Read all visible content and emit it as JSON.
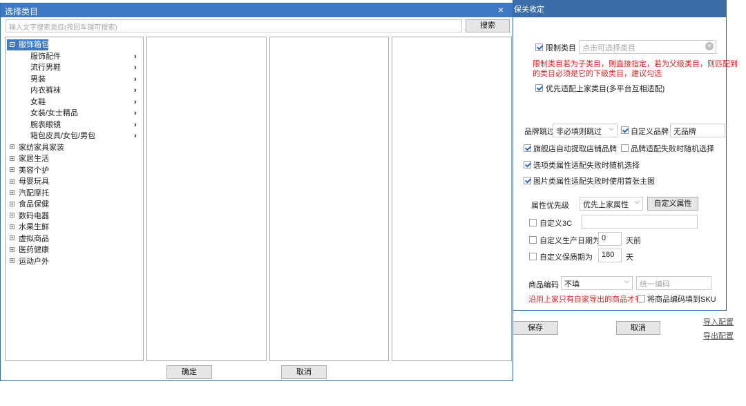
{
  "dialog": {
    "title": "选择类目",
    "close_glyph": "×",
    "search_placeholder": "输入文字搜索类目(按回车键可搜索)",
    "search_button": "搜索",
    "ok_button": "确定",
    "cancel_button": "取消",
    "tree": [
      {
        "label": "服饰箱包",
        "expanded": true,
        "selected": true
      },
      {
        "label": "服饰配件",
        "child": true
      },
      {
        "label": "流行男鞋",
        "child": true
      },
      {
        "label": "男装",
        "child": true
      },
      {
        "label": "内衣裤袜",
        "child": true
      },
      {
        "label": "女鞋",
        "child": true
      },
      {
        "label": "女装/女士精品",
        "child": true
      },
      {
        "label": "腕表眼镜",
        "child": true
      },
      {
        "label": "箱包皮具/女包/男包",
        "child": true
      },
      {
        "label": "家纺家具家装",
        "expanded": false
      },
      {
        "label": "家居生活",
        "expanded": false
      },
      {
        "label": "美容个护",
        "expanded": false
      },
      {
        "label": "母婴玩具",
        "expanded": false
      },
      {
        "label": "汽配摩托",
        "expanded": false
      },
      {
        "label": "食品保健",
        "expanded": false
      },
      {
        "label": "数码电器",
        "expanded": false
      },
      {
        "label": "水果生鲜",
        "expanded": false
      },
      {
        "label": "虚拟商品",
        "expanded": false
      },
      {
        "label": "医药健康",
        "expanded": false
      },
      {
        "label": "运动户外",
        "expanded": false
      }
    ],
    "expand_glyph": "+",
    "collapse_glyph": "−",
    "chevron_glyph": "›"
  },
  "config": {
    "top_partial_text": "保关收定",
    "limit_category_label": "限制类目",
    "limit_category_checked": true,
    "category_placeholder": "点击可选择类目",
    "clear_glyph": "✕",
    "limit_note_line1": "限制类目若为子类目，则直接指定，若为父级类目，则匹配到",
    "limit_note_line2": "的类目必须是它的下级类目，建议勾选",
    "prefer_source_label": "优先适配上家类目(多平台互相适配)",
    "prefer_source_checked": true,
    "brand_skip_label": "品牌跳过",
    "brand_skip_value": "非必填则跳过",
    "custom_brand_label": "自定义品牌",
    "custom_brand_checked": true,
    "custom_brand_value": "无品牌",
    "flagship_label": "旗舰店自动提取店铺品牌",
    "flagship_checked": true,
    "brand_random_label": "品牌适配失败时随机选择",
    "brand_random_checked": false,
    "option_random_label": "选项类属性适配失败时随机选择",
    "option_random_checked": true,
    "image_first_label": "图片类属性适配失败时使用首张主图",
    "image_first_checked": true,
    "attr_priority_label": "属性优先级",
    "attr_priority_value": "优先上家属性",
    "custom_attr_button": "自定义属性",
    "custom_3c_label": "自定义3C",
    "custom_3c_checked": false,
    "custom_3c_value": "",
    "prod_date_label": "自定义生产日期为",
    "prod_date_checked": false,
    "prod_date_value": "0",
    "prod_date_unit": "天前",
    "shelf_life_label": "自定义保质期为",
    "shelf_life_checked": false,
    "shelf_life_value": "180",
    "shelf_life_unit": "天",
    "product_code_label": "商品编码",
    "product_code_value": "不填",
    "unified_code_placeholder": "统一编码",
    "code_note": "沿用上家只有自家导出的商品才有",
    "code_to_sku_label": "将商品编码填到SKU",
    "code_to_sku_checked": false,
    "save_button": "保存",
    "cancel_button": "取消",
    "import_link": "导入配置",
    "export_link": "导出配置",
    "dropdown_glyph": "⌵"
  }
}
